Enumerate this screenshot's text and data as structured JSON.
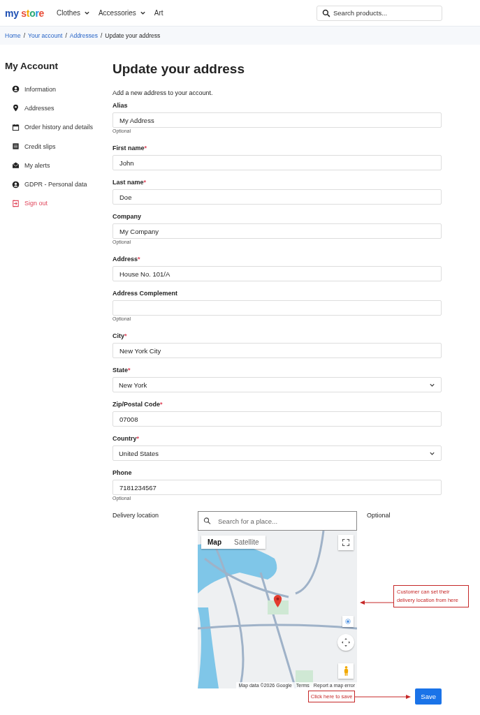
{
  "header": {
    "logo": "my store",
    "nav": [
      {
        "label": "Clothes",
        "has_dropdown": true
      },
      {
        "label": "Accessories",
        "has_dropdown": true
      },
      {
        "label": "Art",
        "has_dropdown": false
      }
    ],
    "search": {
      "placeholder": "Search products..."
    }
  },
  "breadcrumb": {
    "separator": "/",
    "items": [
      {
        "label": "Home",
        "link": true
      },
      {
        "label": "Your account",
        "link": true
      },
      {
        "label": "Addresses",
        "link": true
      },
      {
        "label": "Update your address",
        "link": false
      }
    ]
  },
  "sidebar": {
    "title": "My Account",
    "items": [
      {
        "label": "Information",
        "kind": "normal"
      },
      {
        "label": "Addresses",
        "kind": "normal"
      },
      {
        "label": "Order history and details",
        "kind": "normal"
      },
      {
        "label": "Credit slips",
        "kind": "normal"
      },
      {
        "label": "My alerts",
        "kind": "normal"
      },
      {
        "label": "GDPR - Personal data",
        "kind": "normal"
      },
      {
        "label": "Sign out",
        "kind": "danger"
      }
    ]
  },
  "form": {
    "title": "Update your address",
    "intro": "Add a new address to your account.",
    "required_mark": "*",
    "fields": [
      {
        "kind": "text",
        "label": "Alias",
        "required": false,
        "value": "My Address",
        "note": "Optional"
      },
      {
        "kind": "text",
        "label": "First name",
        "required": true,
        "value": "John"
      },
      {
        "kind": "text",
        "label": "Last name",
        "required": true,
        "value": "Doe"
      },
      {
        "kind": "text",
        "label": "Company",
        "required": false,
        "value": "My Company",
        "note": "Optional"
      },
      {
        "kind": "text",
        "label": "Address",
        "required": true,
        "value": "House No. 101/A"
      },
      {
        "kind": "text",
        "label": "Address Complement",
        "required": false,
        "note": "Optional"
      },
      {
        "kind": "text",
        "label": "City",
        "required": true,
        "value": "New York City"
      },
      {
        "kind": "select",
        "label": "State",
        "required": true,
        "value": "New York"
      },
      {
        "kind": "text",
        "label": "Zip/Postal Code",
        "required": true,
        "value": "07008"
      },
      {
        "kind": "select",
        "label": "Country",
        "required": true,
        "value": "United States"
      },
      {
        "kind": "text",
        "label": "Phone",
        "required": false,
        "value": "7181234567",
        "note": "Optional"
      }
    ]
  },
  "delivery": {
    "label": "Delivery location",
    "search_placeholder": "Search for a place...",
    "note": "Optional",
    "map_types": [
      {
        "label": "Map",
        "selected": true
      },
      {
        "label": "Satellite",
        "selected": false
      }
    ],
    "attribution": [
      "Map data ©2026 Google",
      "Terms",
      "Report a map error"
    ],
    "annotation": "Customer can set their delivery location from here"
  },
  "save": {
    "label": "Save",
    "annotation": "Click here to save"
  }
}
